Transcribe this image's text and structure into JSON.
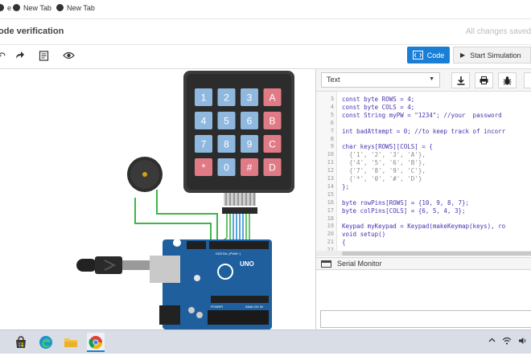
{
  "bookmarks": [
    {
      "label": "e"
    },
    {
      "label": "New Tab"
    },
    {
      "label": "New Tab"
    }
  ],
  "header": {
    "title": "ode verification",
    "save_status": "All changes saved"
  },
  "toolbar": {
    "code_label": "Code",
    "sim_label": "Start Simulation"
  },
  "editor": {
    "mode": "Text",
    "lines": [
      {
        "n": "3",
        "text": "const byte ROWS = 4;",
        "color": "#4b2fb0"
      },
      {
        "n": "4",
        "text": "const byte COLS = 4;",
        "color": "#4b2fb0"
      },
      {
        "n": "5",
        "text": "const String myPW = \"1234\"; //your  password",
        "color": "#4b2fb0"
      },
      {
        "n": "6",
        "text": "",
        "color": "#333333"
      },
      {
        "n": "7",
        "text": "int badAttempt = 0; //to keep track of incorr",
        "color": "#4b2fb0"
      },
      {
        "n": "8",
        "text": "",
        "color": "#333333"
      },
      {
        "n": "9",
        "text": "char keys[ROWS][COLS] = {",
        "color": "#4b2fb0"
      },
      {
        "n": "10",
        "text": "  {'1', '2', '3', 'A'},",
        "color": "#8a8a8a"
      },
      {
        "n": "11",
        "text": "  {'4', '5', '6', 'B'},",
        "color": "#8a8a8a"
      },
      {
        "n": "12",
        "text": "  {'7', '8', '9', 'C'},",
        "color": "#8a8a8a"
      },
      {
        "n": "13",
        "text": "  {'*', '0', '#', 'D'}",
        "color": "#8a8a8a"
      },
      {
        "n": "14",
        "text": "};",
        "color": "#4b2fb0"
      },
      {
        "n": "15",
        "text": "",
        "color": "#333333"
      },
      {
        "n": "16",
        "text": "byte rowPins[ROWS] = {10, 9, 8, 7};",
        "color": "#4b2fb0"
      },
      {
        "n": "17",
        "text": "byte colPins[COLS] = {6, 5, 4, 3};",
        "color": "#4b2fb0"
      },
      {
        "n": "18",
        "text": "",
        "color": "#333333"
      },
      {
        "n": "19",
        "text": "Keypad myKeypad = Keypad(makeKeymap(keys), ro",
        "color": "#4b2fb0"
      },
      {
        "n": "20",
        "text": "void setup()",
        "color": "#4b2fb0"
      },
      {
        "n": "21",
        "text": "{",
        "color": "#4b2fb0"
      },
      {
        "n": "22",
        "text": "",
        "color": "#333333"
      }
    ]
  },
  "serial": {
    "label": "Serial Monitor"
  },
  "keypad": {
    "keys": [
      "1",
      "2",
      "3",
      "A",
      "4",
      "5",
      "6",
      "B",
      "7",
      "8",
      "9",
      "C",
      "*",
      "0",
      "#",
      "D"
    ]
  },
  "board": {
    "model": "UNO",
    "labels": [
      "DIGITAL (PWM~)",
      "POWER",
      "ANALOG IN"
    ]
  },
  "colors": {
    "accent": "#1a7fd4",
    "key_blue": "#8fb8df",
    "key_red": "#e07b86",
    "keypad_body": "#3b3b3b",
    "board_blue": "#1f5f9e",
    "wire_green": "#3fb54a"
  }
}
